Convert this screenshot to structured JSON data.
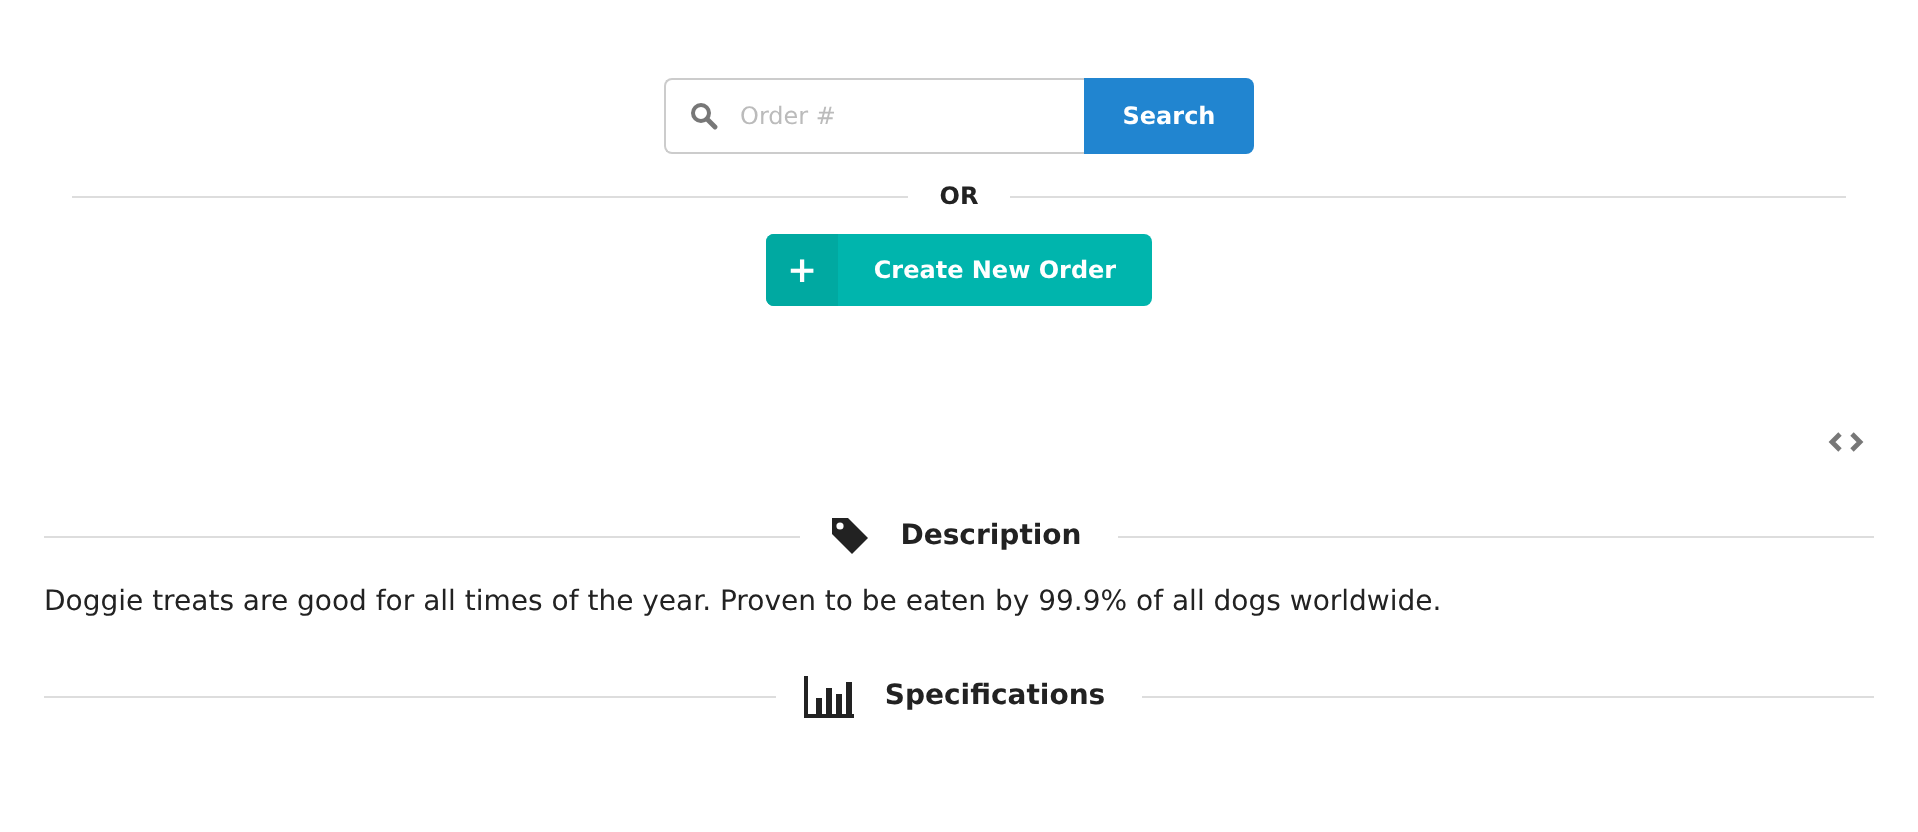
{
  "search": {
    "placeholder": "Order #",
    "button": "Search"
  },
  "divider": "OR",
  "create_button": {
    "icon": "+",
    "label": "Create New Order"
  },
  "sections": [
    {
      "kind": "tag",
      "title": "Description",
      "text": "Doggie treats are good for all times of the year. Proven to be eaten by 99.9% of all dogs worldwide."
    },
    {
      "kind": "chart",
      "title": "Specifications"
    }
  ]
}
